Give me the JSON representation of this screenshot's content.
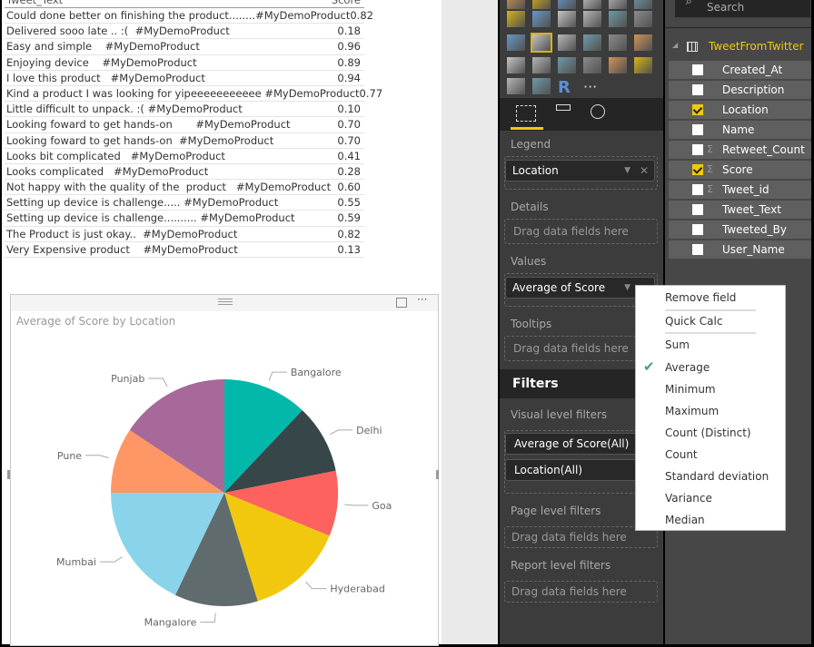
{
  "table": {
    "headers": [
      "Tweet_Text",
      "Score"
    ],
    "rows": [
      [
        "Could done better on finishing the product........#MyDemoProduct",
        "0.82"
      ],
      [
        "Delivered sooo late .. :(  #MyDemoProduct",
        "0.18"
      ],
      [
        "Easy and simple    #MyDemoProduct",
        "0.96"
      ],
      [
        "Enjoying device    #MyDemoProduct",
        "0.89"
      ],
      [
        "I love this product   #MyDemoProduct",
        "0.94"
      ],
      [
        "Kind a product I was looking for yipeeeeeeeeeee #MyDemoProduct",
        "0.77"
      ],
      [
        "Little difficult to unpack. :( #MyDemoProduct",
        "0.10"
      ],
      [
        "Looking foward to get hands-on       #MyDemoProduct",
        "0.70"
      ],
      [
        "Looking foward to get hands-on  #MyDemoProduct",
        "0.70"
      ],
      [
        "Looks bit complicated   #MyDemoProduct",
        "0.41"
      ],
      [
        "Looks complicated   #MyDemoProduct",
        "0.28"
      ],
      [
        "Not happy with the quality of the  product   #MyDemoProduct",
        "0.60"
      ],
      [
        "Setting up device is challenge..... #MyDemoProduct",
        "0.55"
      ],
      [
        "Setting up device is challenge.......... #MyDemoProduct",
        "0.59"
      ],
      [
        "The Product is just okay..  #MyDemoProduct",
        "0.82"
      ],
      [
        "Very Expensive product    #MyDemoProduct",
        "0.13"
      ]
    ]
  },
  "chart_data": {
    "type": "pie",
    "title": "Average of Score by Location",
    "categories": [
      "Bangalore",
      "Delhi",
      "Goa",
      "Hyderabad",
      "Mangalore",
      "Mumbai",
      "Pune",
      "Punjab"
    ],
    "values": [
      0.66,
      0.54,
      0.51,
      0.77,
      0.65,
      0.98,
      0.51,
      0.86
    ],
    "colors": [
      "#01b8aa",
      "#374649",
      "#fd625e",
      "#f2c80f",
      "#5f6b6d",
      "#8ad4eb",
      "#fe9666",
      "#a66999"
    ]
  },
  "viz_pane": {
    "tabs": [
      "fields-tab",
      "format-tab",
      "analytics-tab"
    ],
    "legend_label": "Legend",
    "legend_value": "Location",
    "details_label": "Details",
    "values_label": "Values",
    "values_value": "Average of Score",
    "tooltips_label": "Tooltips",
    "drag_placeholder": "Drag data fields here",
    "filters_title": "Filters",
    "visual_filters_label": "Visual level filters",
    "visual_filters": [
      "Average of Score(All)",
      "Location(All)"
    ],
    "page_filters_label": "Page level filters",
    "report_filters_label": "Report level filters",
    "more": "···"
  },
  "fields_pane": {
    "search_placeholder": "Search",
    "table_name": "TweetFromTwitter",
    "accent": "#f2c811",
    "fields": [
      {
        "name": "Created_At",
        "checked": false,
        "sigma": false
      },
      {
        "name": "Description",
        "checked": false,
        "sigma": false
      },
      {
        "name": "Location",
        "checked": true,
        "sigma": false
      },
      {
        "name": "Name",
        "checked": false,
        "sigma": false
      },
      {
        "name": "Retweet_Count",
        "checked": false,
        "sigma": true
      },
      {
        "name": "Score",
        "checked": true,
        "sigma": true
      },
      {
        "name": "Tweet_id",
        "checked": false,
        "sigma": true
      },
      {
        "name": "Tweet_Text",
        "checked": false,
        "sigma": false
      },
      {
        "name": "Tweeted_By",
        "checked": false,
        "sigma": false
      },
      {
        "name": "User_Name",
        "checked": false,
        "sigma": false
      }
    ]
  },
  "menu": {
    "items": [
      "Remove field",
      "Quick Calc",
      "Sum",
      "Average",
      "Minimum",
      "Maximum",
      "Count (Distinct)",
      "Count",
      "Standard deviation",
      "Variance",
      "Median"
    ],
    "selected": "Average"
  }
}
